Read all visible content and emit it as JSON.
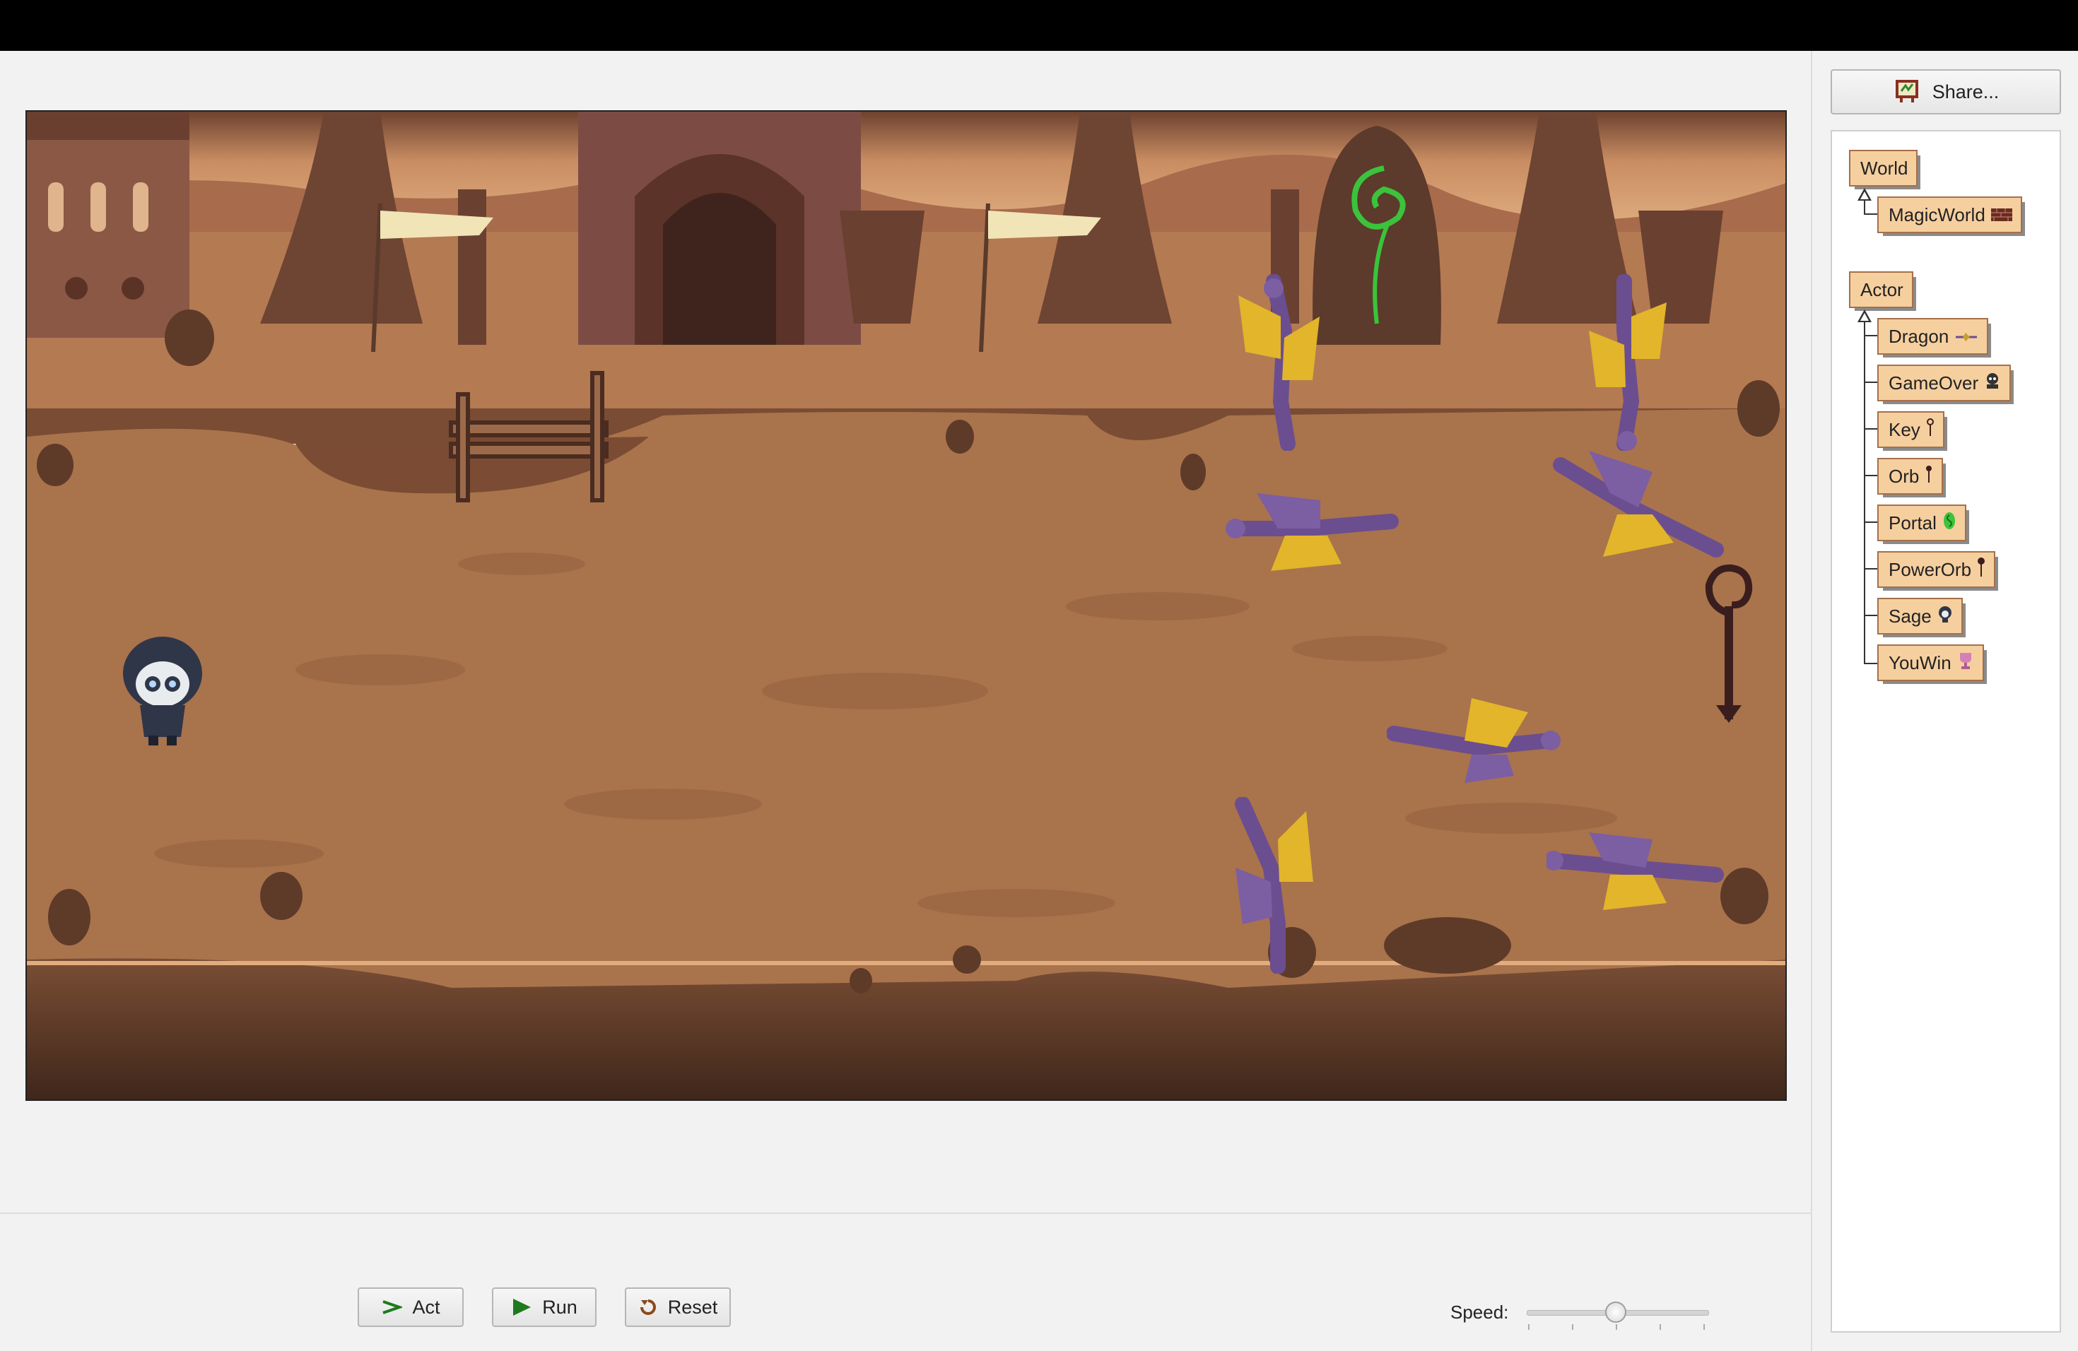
{
  "window": {
    "title_bar": ""
  },
  "controls": {
    "act_label": "Act",
    "run_label": "Run",
    "reset_label": "Reset",
    "speed_label": "Speed:",
    "speed_value": 0.5
  },
  "share": {
    "label": "Share..."
  },
  "class_tree": {
    "world_group": {
      "root": "World",
      "subclasses": [
        {
          "label": "MagicWorld",
          "icon": "brick-wall-icon"
        }
      ]
    },
    "actor_group": {
      "root": "Actor",
      "subclasses": [
        {
          "label": "Dragon",
          "icon": "dragon-icon"
        },
        {
          "label": "GameOver",
          "icon": "skull-icon"
        },
        {
          "label": "Key",
          "icon": "key-icon"
        },
        {
          "label": "Orb",
          "icon": "orb-staff-icon"
        },
        {
          "label": "Portal",
          "icon": "portal-icon"
        },
        {
          "label": "PowerOrb",
          "icon": "power-orb-icon"
        },
        {
          "label": "Sage",
          "icon": "sage-icon"
        },
        {
          "label": "YouWin",
          "icon": "trophy-icon"
        }
      ]
    }
  },
  "world": {
    "name": "MagicWorld",
    "colors": {
      "ground": "#a9734c",
      "path_dark": "#9a6644",
      "sky": "#d9a878",
      "cliff": "#5c3a28"
    }
  }
}
